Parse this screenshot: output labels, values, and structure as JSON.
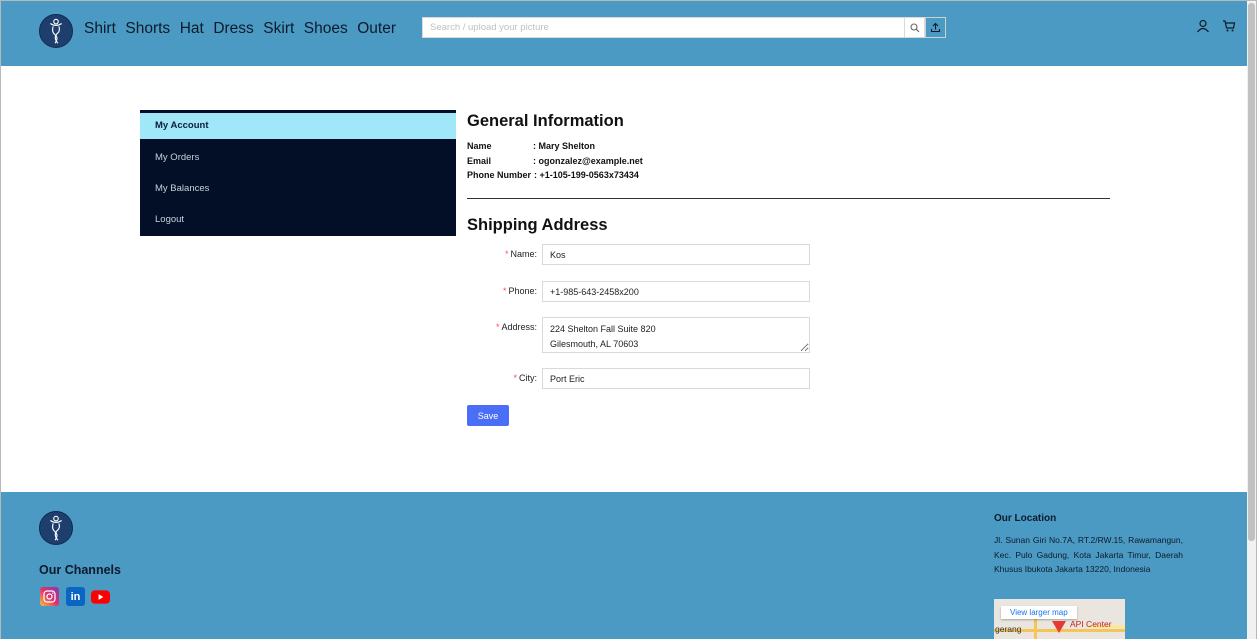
{
  "header": {
    "nav": [
      "Shirt",
      "Shorts",
      "Hat",
      "Dress",
      "Skirt",
      "Shoes",
      "Outer"
    ],
    "search_placeholder": "Search / upload your picture",
    "icons": [
      "search-icon",
      "upload-icon",
      "user-icon",
      "cart-icon"
    ]
  },
  "sidebar": {
    "items": [
      {
        "label": "My Account",
        "active": true
      },
      {
        "label": "My Orders",
        "active": false
      },
      {
        "label": "My Balances",
        "active": false
      },
      {
        "label": "Logout",
        "active": false
      }
    ]
  },
  "general": {
    "title": "General Information",
    "rows": [
      {
        "label": "Name",
        "value": ": Mary Shelton"
      },
      {
        "label": "Email",
        "value": ": ogonzalez@example.net"
      },
      {
        "label": "Phone Number",
        "value": ": +1-105-199-0563x73434"
      }
    ]
  },
  "shipping": {
    "title": "Shipping Address",
    "fields": {
      "name": {
        "label": "Name",
        "value": "Kos"
      },
      "phone": {
        "label": "Phone",
        "value": "+1-985-643-2458x200"
      },
      "address": {
        "label": "Address",
        "value": "224 Shelton Fall Suite 820\nGilesmouth, AL 70603"
      },
      "city": {
        "label": "City",
        "value": "Port Eric"
      }
    },
    "save_label": "Save"
  },
  "footer": {
    "channels_title": "Our Channels",
    "channels": [
      "instagram-icon",
      "linkedin-icon",
      "youtube-icon"
    ],
    "location_title": "Our Location",
    "location_text": "Jl. Sunan Giri No.7A, RT.2/RW.15, Rawamangun, Kec. Pulo Gadung, Kota Jakarta Timur, Daerah Khusus Ibukota Jakarta 13220, Indonesia",
    "map": {
      "button": "View larger map",
      "label_left": "gerang",
      "label_right": "API Center"
    }
  },
  "colors": {
    "header_bg": "#4a9ac4",
    "sidebar_bg": "#020f26",
    "sidebar_active": "#a0e7fa",
    "primary_button": "#4a6ef5"
  }
}
